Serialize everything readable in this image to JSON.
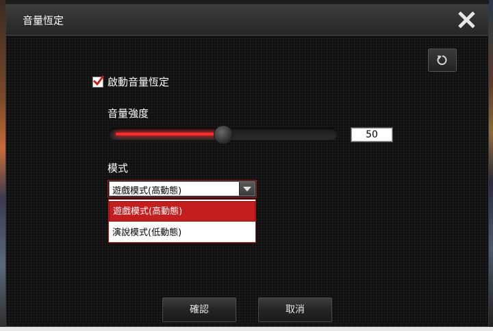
{
  "dialog": {
    "title": "音量恆定",
    "close_icon": "close-icon",
    "reset_icon": "reset-icon"
  },
  "enable": {
    "label": "啟動音量恆定",
    "checked": true
  },
  "volume": {
    "label": "音量強度",
    "value": "50",
    "level_percent": 50,
    "accent_color": "#ff2a2a"
  },
  "mode": {
    "label": "模式",
    "selected": "遊戲模式(高動態)",
    "options": [
      "遊戲模式(高動態)",
      "演說模式(低動態)"
    ],
    "highlight_color": "#c41e1e"
  },
  "buttons": {
    "confirm": "確認",
    "cancel": "取消"
  }
}
